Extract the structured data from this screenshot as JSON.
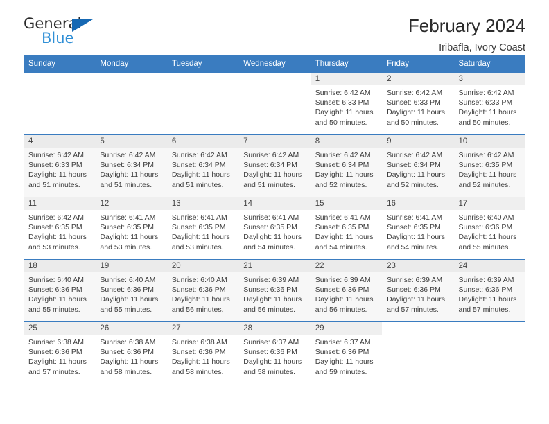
{
  "logo": {
    "word_top": "General",
    "word_bottom": "Blue",
    "triangle_color": "#1668b3",
    "blue_text_color": "#2f8fd6"
  },
  "header": {
    "title": "February 2024",
    "location": "Iribafla, Ivory Coast"
  },
  "theme": {
    "header_bg": "#3a7cc0",
    "row_border": "#3a7cc0",
    "alt_row_bg": "#f7f7f7",
    "daynum_band_bg": "#efefef"
  },
  "calendar": {
    "weekday_headers": [
      "Sunday",
      "Monday",
      "Tuesday",
      "Wednesday",
      "Thursday",
      "Friday",
      "Saturday"
    ],
    "weeks": [
      {
        "alt": false,
        "days": [
          {
            "num": "",
            "sunrise": "",
            "sunset": "",
            "daylight1": "",
            "daylight2": ""
          },
          {
            "num": "",
            "sunrise": "",
            "sunset": "",
            "daylight1": "",
            "daylight2": ""
          },
          {
            "num": "",
            "sunrise": "",
            "sunset": "",
            "daylight1": "",
            "daylight2": ""
          },
          {
            "num": "",
            "sunrise": "",
            "sunset": "",
            "daylight1": "",
            "daylight2": ""
          },
          {
            "num": "1",
            "sunrise": "Sunrise: 6:42 AM",
            "sunset": "Sunset: 6:33 PM",
            "daylight1": "Daylight: 11 hours",
            "daylight2": "and 50 minutes."
          },
          {
            "num": "2",
            "sunrise": "Sunrise: 6:42 AM",
            "sunset": "Sunset: 6:33 PM",
            "daylight1": "Daylight: 11 hours",
            "daylight2": "and 50 minutes."
          },
          {
            "num": "3",
            "sunrise": "Sunrise: 6:42 AM",
            "sunset": "Sunset: 6:33 PM",
            "daylight1": "Daylight: 11 hours",
            "daylight2": "and 50 minutes."
          }
        ]
      },
      {
        "alt": true,
        "days": [
          {
            "num": "4",
            "sunrise": "Sunrise: 6:42 AM",
            "sunset": "Sunset: 6:33 PM",
            "daylight1": "Daylight: 11 hours",
            "daylight2": "and 51 minutes."
          },
          {
            "num": "5",
            "sunrise": "Sunrise: 6:42 AM",
            "sunset": "Sunset: 6:34 PM",
            "daylight1": "Daylight: 11 hours",
            "daylight2": "and 51 minutes."
          },
          {
            "num": "6",
            "sunrise": "Sunrise: 6:42 AM",
            "sunset": "Sunset: 6:34 PM",
            "daylight1": "Daylight: 11 hours",
            "daylight2": "and 51 minutes."
          },
          {
            "num": "7",
            "sunrise": "Sunrise: 6:42 AM",
            "sunset": "Sunset: 6:34 PM",
            "daylight1": "Daylight: 11 hours",
            "daylight2": "and 51 minutes."
          },
          {
            "num": "8",
            "sunrise": "Sunrise: 6:42 AM",
            "sunset": "Sunset: 6:34 PM",
            "daylight1": "Daylight: 11 hours",
            "daylight2": "and 52 minutes."
          },
          {
            "num": "9",
            "sunrise": "Sunrise: 6:42 AM",
            "sunset": "Sunset: 6:34 PM",
            "daylight1": "Daylight: 11 hours",
            "daylight2": "and 52 minutes."
          },
          {
            "num": "10",
            "sunrise": "Sunrise: 6:42 AM",
            "sunset": "Sunset: 6:35 PM",
            "daylight1": "Daylight: 11 hours",
            "daylight2": "and 52 minutes."
          }
        ]
      },
      {
        "alt": false,
        "days": [
          {
            "num": "11",
            "sunrise": "Sunrise: 6:42 AM",
            "sunset": "Sunset: 6:35 PM",
            "daylight1": "Daylight: 11 hours",
            "daylight2": "and 53 minutes."
          },
          {
            "num": "12",
            "sunrise": "Sunrise: 6:41 AM",
            "sunset": "Sunset: 6:35 PM",
            "daylight1": "Daylight: 11 hours",
            "daylight2": "and 53 minutes."
          },
          {
            "num": "13",
            "sunrise": "Sunrise: 6:41 AM",
            "sunset": "Sunset: 6:35 PM",
            "daylight1": "Daylight: 11 hours",
            "daylight2": "and 53 minutes."
          },
          {
            "num": "14",
            "sunrise": "Sunrise: 6:41 AM",
            "sunset": "Sunset: 6:35 PM",
            "daylight1": "Daylight: 11 hours",
            "daylight2": "and 54 minutes."
          },
          {
            "num": "15",
            "sunrise": "Sunrise: 6:41 AM",
            "sunset": "Sunset: 6:35 PM",
            "daylight1": "Daylight: 11 hours",
            "daylight2": "and 54 minutes."
          },
          {
            "num": "16",
            "sunrise": "Sunrise: 6:41 AM",
            "sunset": "Sunset: 6:35 PM",
            "daylight1": "Daylight: 11 hours",
            "daylight2": "and 54 minutes."
          },
          {
            "num": "17",
            "sunrise": "Sunrise: 6:40 AM",
            "sunset": "Sunset: 6:36 PM",
            "daylight1": "Daylight: 11 hours",
            "daylight2": "and 55 minutes."
          }
        ]
      },
      {
        "alt": true,
        "days": [
          {
            "num": "18",
            "sunrise": "Sunrise: 6:40 AM",
            "sunset": "Sunset: 6:36 PM",
            "daylight1": "Daylight: 11 hours",
            "daylight2": "and 55 minutes."
          },
          {
            "num": "19",
            "sunrise": "Sunrise: 6:40 AM",
            "sunset": "Sunset: 6:36 PM",
            "daylight1": "Daylight: 11 hours",
            "daylight2": "and 55 minutes."
          },
          {
            "num": "20",
            "sunrise": "Sunrise: 6:40 AM",
            "sunset": "Sunset: 6:36 PM",
            "daylight1": "Daylight: 11 hours",
            "daylight2": "and 56 minutes."
          },
          {
            "num": "21",
            "sunrise": "Sunrise: 6:39 AM",
            "sunset": "Sunset: 6:36 PM",
            "daylight1": "Daylight: 11 hours",
            "daylight2": "and 56 minutes."
          },
          {
            "num": "22",
            "sunrise": "Sunrise: 6:39 AM",
            "sunset": "Sunset: 6:36 PM",
            "daylight1": "Daylight: 11 hours",
            "daylight2": "and 56 minutes."
          },
          {
            "num": "23",
            "sunrise": "Sunrise: 6:39 AM",
            "sunset": "Sunset: 6:36 PM",
            "daylight1": "Daylight: 11 hours",
            "daylight2": "and 57 minutes."
          },
          {
            "num": "24",
            "sunrise": "Sunrise: 6:39 AM",
            "sunset": "Sunset: 6:36 PM",
            "daylight1": "Daylight: 11 hours",
            "daylight2": "and 57 minutes."
          }
        ]
      },
      {
        "alt": false,
        "days": [
          {
            "num": "25",
            "sunrise": "Sunrise: 6:38 AM",
            "sunset": "Sunset: 6:36 PM",
            "daylight1": "Daylight: 11 hours",
            "daylight2": "and 57 minutes."
          },
          {
            "num": "26",
            "sunrise": "Sunrise: 6:38 AM",
            "sunset": "Sunset: 6:36 PM",
            "daylight1": "Daylight: 11 hours",
            "daylight2": "and 58 minutes."
          },
          {
            "num": "27",
            "sunrise": "Sunrise: 6:38 AM",
            "sunset": "Sunset: 6:36 PM",
            "daylight1": "Daylight: 11 hours",
            "daylight2": "and 58 minutes."
          },
          {
            "num": "28",
            "sunrise": "Sunrise: 6:37 AM",
            "sunset": "Sunset: 6:36 PM",
            "daylight1": "Daylight: 11 hours",
            "daylight2": "and 58 minutes."
          },
          {
            "num": "29",
            "sunrise": "Sunrise: 6:37 AM",
            "sunset": "Sunset: 6:36 PM",
            "daylight1": "Daylight: 11 hours",
            "daylight2": "and 59 minutes."
          },
          {
            "num": "",
            "sunrise": "",
            "sunset": "",
            "daylight1": "",
            "daylight2": ""
          },
          {
            "num": "",
            "sunrise": "",
            "sunset": "",
            "daylight1": "",
            "daylight2": ""
          }
        ]
      }
    ]
  }
}
